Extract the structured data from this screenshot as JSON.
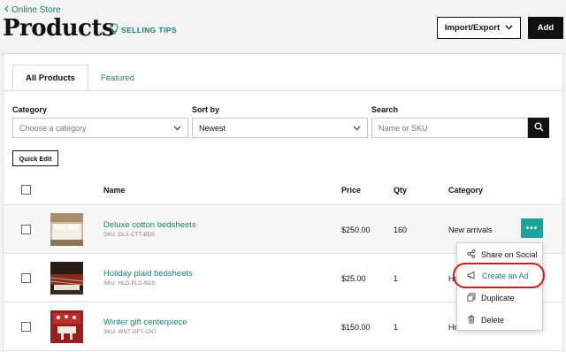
{
  "header": {
    "back_link": "Online Store",
    "title": "Products",
    "selling_tips": "SELLING TIPS",
    "import_export": "Import/Export",
    "add": "Add"
  },
  "tabs": [
    {
      "label": "All Products",
      "active": true
    },
    {
      "label": "Featured",
      "active": false
    }
  ],
  "filters": {
    "category_label": "Category",
    "category_placeholder": "Choose a category",
    "sort_label": "Sort by",
    "sort_value": "Newest",
    "search_label": "Search",
    "search_placeholder": "Name or SKU"
  },
  "quick_edit": "Quick Edit",
  "table": {
    "headers": {
      "name": "Name",
      "price": "Price",
      "qty": "Qty",
      "category": "Category"
    },
    "rows": [
      {
        "name": "Deluxe cotton bedsheets",
        "sku": "SKU: DLX-CTT-BDS",
        "price": "$250.00",
        "qty": "160",
        "category": "New arrivals"
      },
      {
        "name": "Holiday plaid bedsheets",
        "sku": "SKU: HLD-PLD-BDS",
        "price": "$25.00",
        "qty": "1",
        "category": "Ho"
      },
      {
        "name": "Winter gift centerpiece",
        "sku": "SKU: WNT-GFT-CNT",
        "price": "$150.00",
        "qty": "1",
        "category": "Ho"
      }
    ]
  },
  "more_button": "•••",
  "menu": {
    "items": [
      {
        "label": "Share on Social",
        "icon": "share-icon"
      },
      {
        "label": "Create an Ad",
        "icon": "megaphone-icon"
      },
      {
        "label": "Duplicate",
        "icon": "duplicate-icon"
      },
      {
        "label": "Delete",
        "icon": "trash-icon"
      }
    ]
  },
  "colors": {
    "accent": "#1b7d73",
    "more_button": "#1aa398",
    "highlight_ring": "#e0161e"
  }
}
